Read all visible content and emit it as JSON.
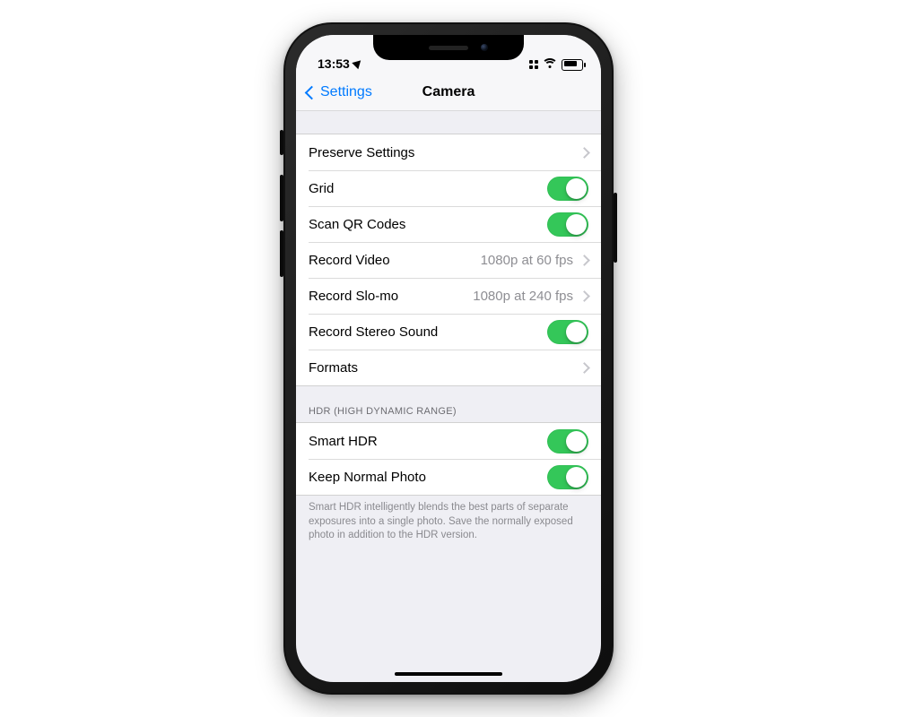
{
  "status": {
    "time": "13:53"
  },
  "nav": {
    "back_label": "Settings",
    "title": "Camera"
  },
  "group1": [
    {
      "label": "Preserve Settings",
      "type": "link"
    },
    {
      "label": "Grid",
      "type": "switch",
      "on": true
    },
    {
      "label": "Scan QR Codes",
      "type": "switch",
      "on": true
    },
    {
      "label": "Record Video",
      "type": "value_link",
      "value": "1080p at 60 fps"
    },
    {
      "label": "Record Slo-mo",
      "type": "value_link",
      "value": "1080p at 240 fps"
    },
    {
      "label": "Record Stereo Sound",
      "type": "switch",
      "on": true
    },
    {
      "label": "Formats",
      "type": "link"
    }
  ],
  "section2": {
    "header": "HDR (HIGH DYNAMIC RANGE)",
    "rows": [
      {
        "label": "Smart HDR",
        "type": "switch",
        "on": true
      },
      {
        "label": "Keep Normal Photo",
        "type": "switch",
        "on": true
      }
    ],
    "footer": "Smart HDR intelligently blends the best parts of separate exposures into a single photo. Save the normally exposed photo in addition to the HDR version."
  }
}
